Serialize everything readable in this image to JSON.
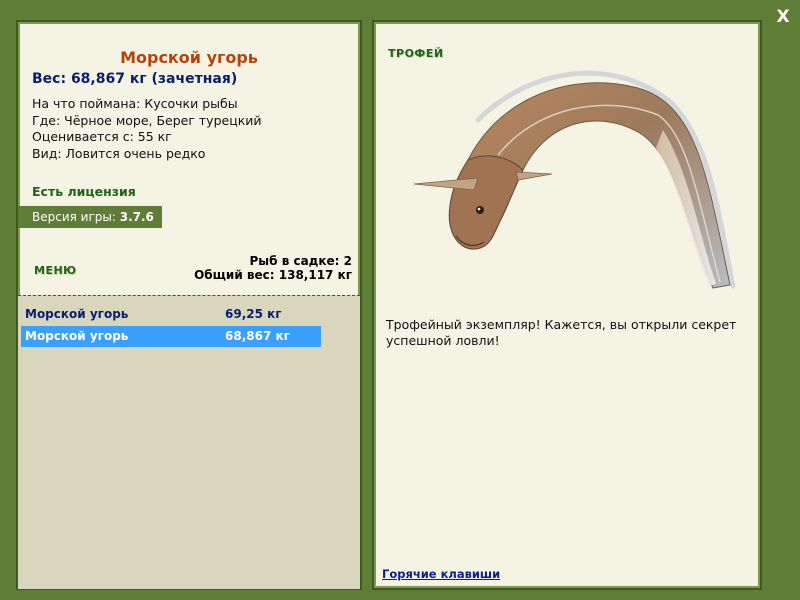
{
  "window": {
    "close_label": "X"
  },
  "fish": {
    "name": "Морской угорь",
    "weight_line": "Вес: 68,867 кг (зачетная)",
    "info": [
      "На что поймана: Кусочки рыбы",
      "Где: Чёрное море, Берег турецкий",
      "Оценивается с: 55 кг",
      "Вид: Ловится очень редко"
    ]
  },
  "license": "Есть лицензия",
  "version": {
    "label": "Версия игры: ",
    "number": "3.7.6"
  },
  "menu_label": "МЕНЮ",
  "keepnet": {
    "count_line": "Рыб в садке: 2",
    "total_line": "Общий вес: 138,117 кг"
  },
  "catch_list": [
    {
      "name": "Морской угорь",
      "weight": "69,25 кг",
      "selected": false
    },
    {
      "name": "Морской угорь",
      "weight": "68,867 кг",
      "selected": true
    }
  ],
  "trophy": {
    "label": "ТРОФЕЙ",
    "text": "Трофейный экземпляр! Кажется, вы открыли секрет успешной ловли!",
    "image": "conger-eel-illustration"
  },
  "hotkeys_label": "Горячие клавиши",
  "colors": {
    "frame": "#5f7d36",
    "panel": "#f5f3e4",
    "list_bg": "#d8d7be",
    "title": "#b8420c",
    "green_text": "#1f6418",
    "navy_text": "#0a1e6e",
    "selection": "#3aa0ff"
  }
}
